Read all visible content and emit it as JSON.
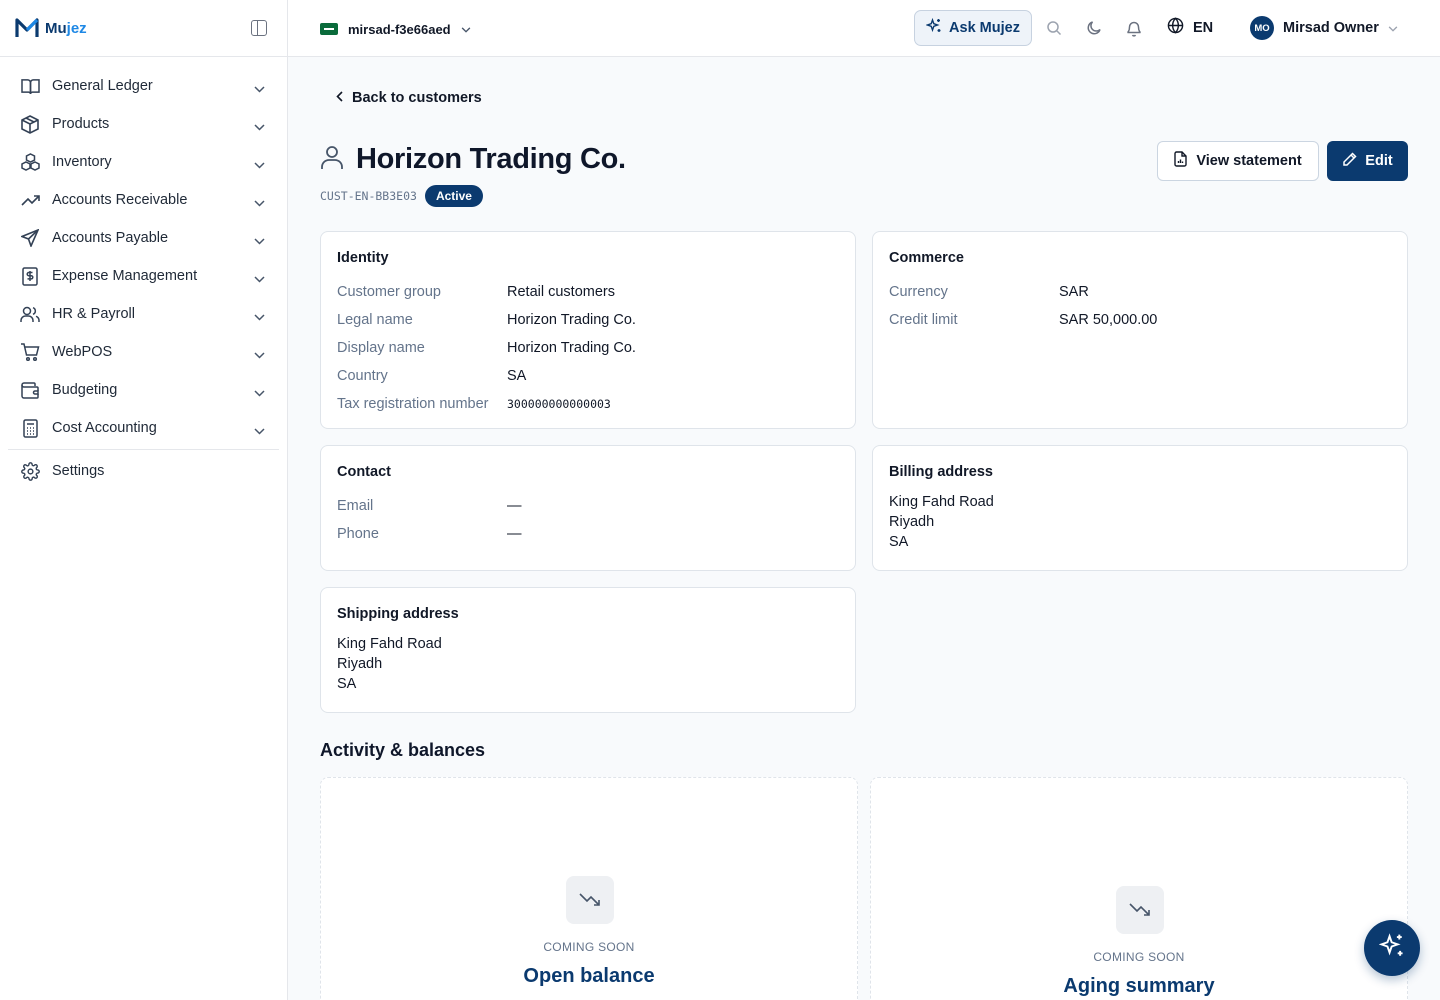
{
  "brand": {
    "name_part1": "Mu",
    "name_part2": "jez"
  },
  "sidebar": {
    "items": [
      {
        "label": "General Ledger",
        "icon": "book-open-icon"
      },
      {
        "label": "Products",
        "icon": "box-icon"
      },
      {
        "label": "Inventory",
        "icon": "boxes-icon"
      },
      {
        "label": "Accounts Receivable",
        "icon": "trending-up-icon"
      },
      {
        "label": "Accounts Payable",
        "icon": "send-icon"
      },
      {
        "label": "Expense Management",
        "icon": "receipt-dollar-icon"
      },
      {
        "label": "HR & Payroll",
        "icon": "users-icon"
      },
      {
        "label": "WebPOS",
        "icon": "shopping-cart-icon"
      },
      {
        "label": "Budgeting",
        "icon": "wallet-icon"
      },
      {
        "label": "Cost Accounting",
        "icon": "calculator-icon"
      }
    ],
    "settings": {
      "label": "Settings",
      "icon": "gear-icon"
    }
  },
  "topbar": {
    "org": "mirsad-f3e66aed",
    "ask_label": "Ask Mujez",
    "language": "EN",
    "user": {
      "initials": "MO",
      "name": "Mirsad Owner"
    }
  },
  "page": {
    "back_label": "Back to customers",
    "title": "Horizon Trading Co.",
    "code": "CUST-EN-BB3E03",
    "status": "Active",
    "view_statement_label": "View statement",
    "edit_label": "Edit"
  },
  "identity": {
    "title": "Identity",
    "rows": [
      {
        "k": "Customer group",
        "v": "Retail customers"
      },
      {
        "k": "Legal name",
        "v": "Horizon Trading Co."
      },
      {
        "k": "Display name",
        "v": "Horizon Trading Co."
      },
      {
        "k": "Country",
        "v": "SA"
      },
      {
        "k": "Tax registration number",
        "v": "300000000000003"
      }
    ]
  },
  "commerce": {
    "title": "Commerce",
    "rows": [
      {
        "k": "Currency",
        "v": "SAR"
      },
      {
        "k": "Credit limit",
        "v": "SAR 50,000.00"
      }
    ]
  },
  "contact": {
    "title": "Contact",
    "rows": [
      {
        "k": "Email",
        "v": "—"
      },
      {
        "k": "Phone",
        "v": "—"
      }
    ]
  },
  "billing": {
    "title": "Billing address",
    "lines": [
      "King Fahd Road",
      "Riyadh",
      "SA"
    ]
  },
  "shipping": {
    "title": "Shipping address",
    "lines": [
      "King Fahd Road",
      "Riyadh",
      "SA"
    ]
  },
  "activity": {
    "title": "Activity & balances",
    "cards": [
      {
        "tag": "COMING SOON",
        "title": "Open balance",
        "icon": "trending-down-icon"
      },
      {
        "tag": "COMING SOON",
        "title": "Aging summary",
        "icon": "trending-down-icon"
      }
    ]
  },
  "colors": {
    "brand": "#0b3a6f",
    "accent": "#1e88e5",
    "muted": "#64748b"
  }
}
